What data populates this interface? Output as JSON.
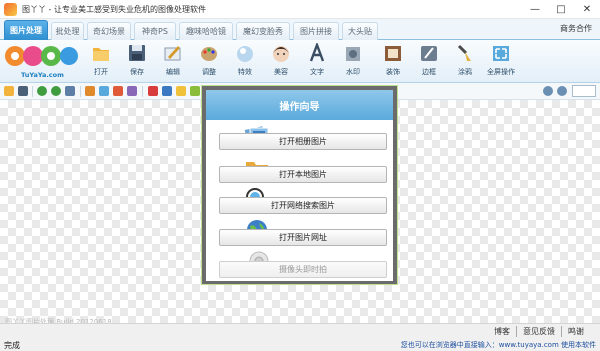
{
  "window": {
    "title": "图丫丫 - 让专业美工感受到失业危机的图像处理软件",
    "controls": [
      "—",
      "□",
      "✕"
    ]
  },
  "tabs": [
    "图片处理",
    "批处理",
    "奇幻场景",
    "神奇PS",
    "趣味哈哈镜",
    "魔幻变脸秀",
    "图片拼接",
    "大头贴"
  ],
  "business": "商务合作",
  "logo": {
    "text": "TuYaYa.com"
  },
  "ribbon": [
    "打开",
    "保存",
    "编辑",
    "调整",
    "特效",
    "美容",
    "文字",
    "水印",
    "装饰",
    "边框",
    "涂鸦",
    "全屏操作"
  ],
  "canvas": {
    "watermark": "图丫丫图片处理 Build 20120618"
  },
  "dialog": {
    "title": "操作向导",
    "buttons": [
      "打开相册图片",
      "打开本地图片",
      "打开网络搜索图片",
      "打开图片网址",
      "摄像头即时拍"
    ]
  },
  "status": {
    "links": [
      "博客",
      "意见反馈",
      "鸣谢"
    ],
    "left": "完成",
    "right": "您也可以在浏览器中直接输入：www.tuyaya.com 使用本软件"
  }
}
